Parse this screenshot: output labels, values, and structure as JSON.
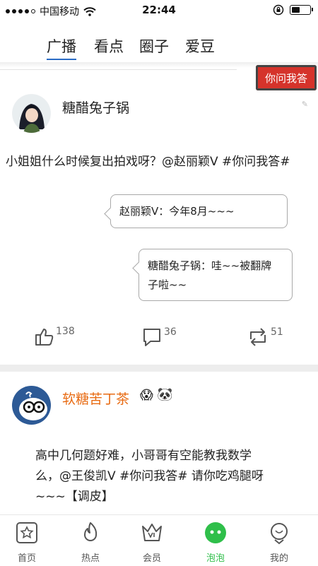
{
  "status": {
    "carrier": "中国移动",
    "time": "22:44"
  },
  "tabs": [
    {
      "label": "广播"
    },
    {
      "label": "看点"
    },
    {
      "label": "圈子"
    },
    {
      "label": "爱豆"
    }
  ],
  "ask_pill": "你问我答",
  "post1": {
    "author": "糖醋兔子锅",
    "content": "小姐姐什么时候复出拍戏呀？@赵丽颖V #你问我答#",
    "reply1": "赵丽颖V：今年8月~~~",
    "reply2_line1": "糖醋兔子锅：哇~~被翻牌",
    "reply2_line2": "子啦~~",
    "likes": "138",
    "comments": "36",
    "reposts": "51"
  },
  "post2": {
    "author": "软糖苦丁茶",
    "line1": "高中几何题好难，小哥哥有空能教我数学",
    "line2": "么，@王俊凯V #你问我答#   请你吃鸡腿呀",
    "line3": "~~~【调皮】"
  },
  "bottom_nav": [
    {
      "label": "首页",
      "icon": "star-icon"
    },
    {
      "label": "热点",
      "icon": "flame-icon"
    },
    {
      "label": "会员",
      "icon": "vip-crown-icon"
    },
    {
      "label": "泡泡",
      "icon": "bubble-icon",
      "active_color": "#2fbf4a"
    },
    {
      "label": "我的",
      "icon": "profile-icon"
    }
  ],
  "colors": {
    "accent_blue": "#2a6cc5",
    "pill_red": "#d5332b",
    "nick_orange": "#e86b13",
    "active_green": "#2fbf4a"
  }
}
